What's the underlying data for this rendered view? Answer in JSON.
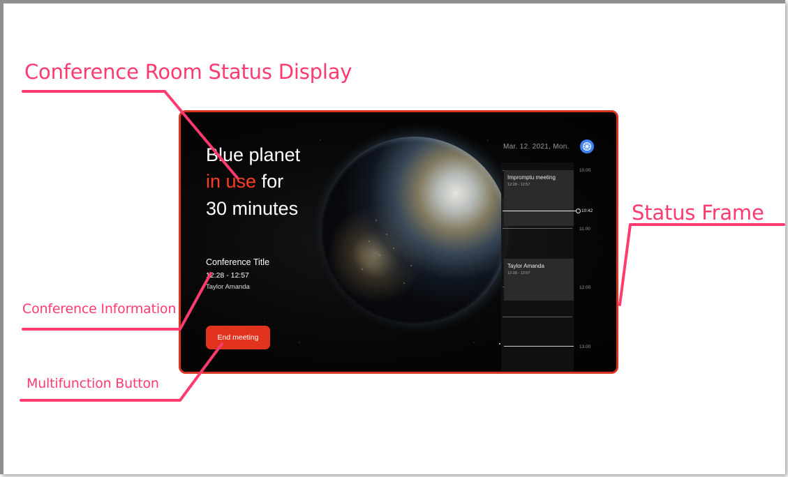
{
  "annotations": {
    "status_display": "Conference Room Status Display",
    "status_frame": "Status Frame",
    "conference_information": "Conference Information",
    "multifunction_button": "Multifunction Button"
  },
  "device": {
    "status": {
      "line1": "Blue planet",
      "line2_highlight": "in use",
      "line2_rest": " for",
      "line3": "30 minutes"
    },
    "conference": {
      "title": "Conference Title",
      "time": "12:28 - 12:57",
      "host": "Taylor Amanda"
    },
    "end_button_label": "End meeting",
    "date": "Mar. 12. 2021, Mon.",
    "timeline": {
      "hours": [
        "10.00",
        "11.00",
        "12.00",
        "13.00"
      ],
      "now": "10:42",
      "events": [
        {
          "title": "Impromptu meeting",
          "time": "12:28 - 12:57"
        },
        {
          "title": "Taylor Amanda",
          "time": "12:28 - 12:57"
        }
      ]
    }
  },
  "colors": {
    "annotation": "#ff3a6f",
    "accent_red": "#e2331f",
    "logo_blue": "#3d82f0"
  }
}
